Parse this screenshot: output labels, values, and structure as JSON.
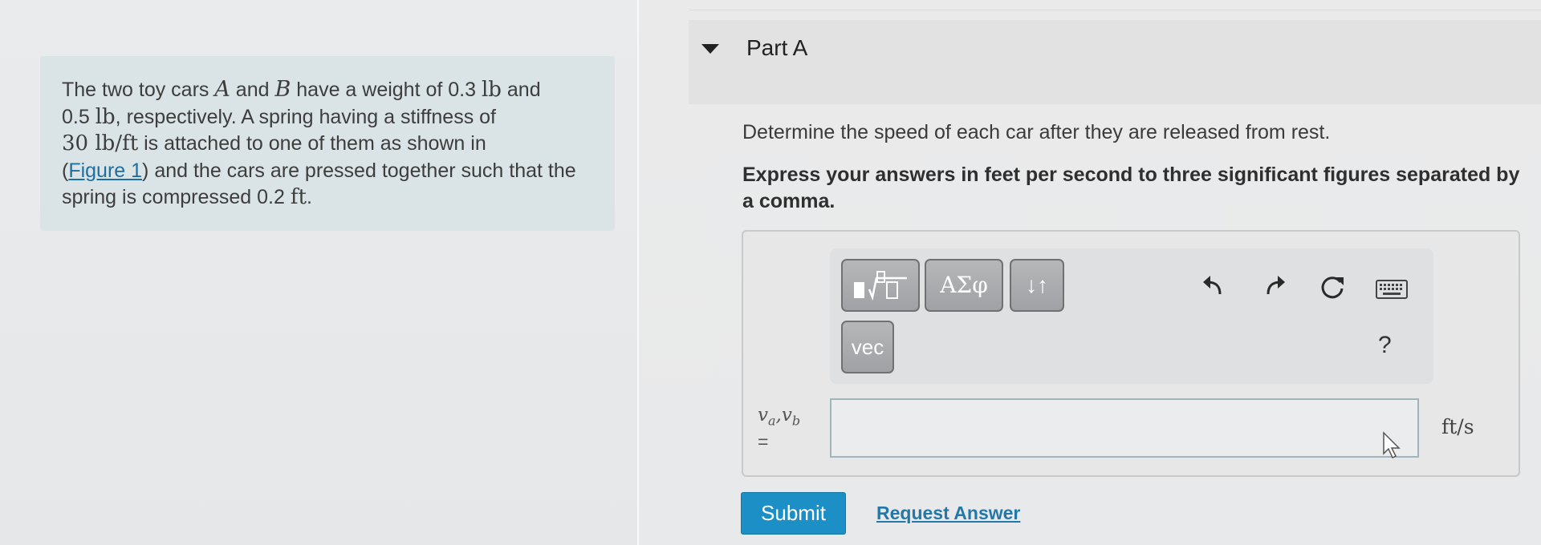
{
  "problem": {
    "seg1": "The two toy cars ",
    "car_a": "A",
    "seg2": " and ",
    "car_b": "B",
    "seg3": " have a weight of 0.3 ",
    "unit_lb1": "lb",
    "seg4": " and",
    "seg5": "0.5 ",
    "unit_lb2": "lb",
    "seg6": ", respectively. A spring having a stiffness of",
    "stiffness": "30 lb/ft",
    "seg7": " is attached to one of them as shown in",
    "paren_open": "(",
    "figure_link": "Figure 1",
    "seg8": ") and the cars are pressed together such that the",
    "seg9": "spring is compressed 0.2 ",
    "unit_ft": "ft",
    "seg10": "."
  },
  "part": {
    "title": "Part A",
    "question": "Determine the speed of each car after they are released from rest.",
    "instruction": "Express your answers in feet per second to three significant figures separated by a comma."
  },
  "toolbar": {
    "greek_label": "ΑΣφ",
    "arrows_label": "↓↑",
    "vec_label": "vec",
    "help_label": "?",
    "icons": [
      "templates-icon",
      "greek-icon",
      "arrows-icon",
      "undo-icon",
      "redo-icon",
      "reset-icon",
      "keyboard-icon",
      "help-icon"
    ]
  },
  "answer": {
    "variable_main": "v",
    "sub_a": "a",
    "comma": ",",
    "sub_b": "b",
    "equals": "=",
    "value": "",
    "unit": "ft/s"
  },
  "actions": {
    "submit_label": "Submit",
    "request_label": "Request Answer"
  },
  "colors": {
    "submit": "#1b8fc6",
    "link": "#1d6fa0",
    "problem_bg": "#dae3e5"
  }
}
